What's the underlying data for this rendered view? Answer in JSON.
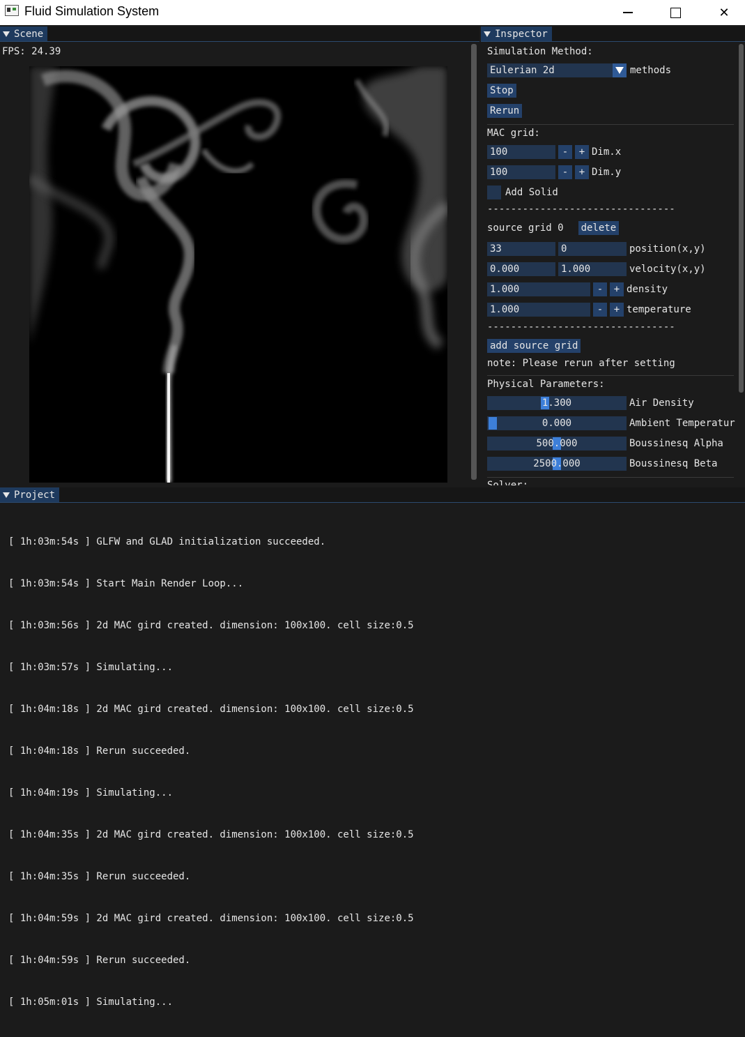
{
  "window": {
    "title": "Fluid Simulation System",
    "min_symbol": "—",
    "close_symbol": "✕"
  },
  "scene": {
    "tab": "Scene",
    "fps": "FPS: 24.39"
  },
  "inspector": {
    "tab": "Inspector",
    "sim_method_label": "Simulation Method:",
    "method_value": "Eulerian 2d",
    "method_suffix": "methods",
    "stop": "Stop",
    "rerun": "Rerun",
    "mac_label": "MAC grid:",
    "dimx": {
      "value": "100",
      "minus": "-",
      "plus": "+",
      "label": "Dim.x"
    },
    "dimy": {
      "value": "100",
      "minus": "-",
      "plus": "+",
      "label": "Dim.y"
    },
    "add_solid": "Add Solid",
    "dashes": "--------------------------------",
    "source_label": "source grid 0",
    "delete": "delete",
    "position": {
      "x": "33",
      "y": "0",
      "label": "position(x,y)"
    },
    "velocity": {
      "x": "0.000",
      "y": "1.000",
      "label": "velocity(x,y)"
    },
    "density": {
      "value": "1.000",
      "minus": "-",
      "plus": "+",
      "label": "density"
    },
    "temperature": {
      "value": "1.000",
      "minus": "-",
      "plus": "+",
      "label": "temperature"
    },
    "add_source": "add source grid",
    "note": "note: Please rerun after setting",
    "phys_label": "Physical Parameters:",
    "air_density": {
      "value": "1.300",
      "label": "Air Density"
    },
    "ambient": {
      "value": "0.000",
      "label": "Ambient Temperatur"
    },
    "alpha": {
      "value": "500.000",
      "label": "Boussinesq Alpha"
    },
    "beta": {
      "value": "2500.000",
      "label": "Boussinesq Beta"
    },
    "solver_cut": "Solver:"
  },
  "project": {
    "tab": "Project",
    "logs": [
      "[ 1h:03m:54s ] GLFW and GLAD initialization succeeded.",
      "[ 1h:03m:54s ] Start Main Render Loop...",
      "[ 1h:03m:56s ] 2d MAC gird created. dimension: 100x100. cell size:0.5",
      "[ 1h:03m:57s ] Simulating...",
      "[ 1h:04m:18s ] 2d MAC gird created. dimension: 100x100. cell size:0.5",
      "[ 1h:04m:18s ] Rerun succeeded.",
      "[ 1h:04m:19s ] Simulating...",
      "[ 1h:04m:35s ] 2d MAC gird created. dimension: 100x100. cell size:0.5",
      "[ 1h:04m:35s ] Rerun succeeded.",
      "[ 1h:04m:59s ] 2d MAC gird created. dimension: 100x100. cell size:0.5",
      "[ 1h:04m:59s ] Rerun succeeded.",
      "[ 1h:05m:01s ] Simulating..."
    ]
  }
}
